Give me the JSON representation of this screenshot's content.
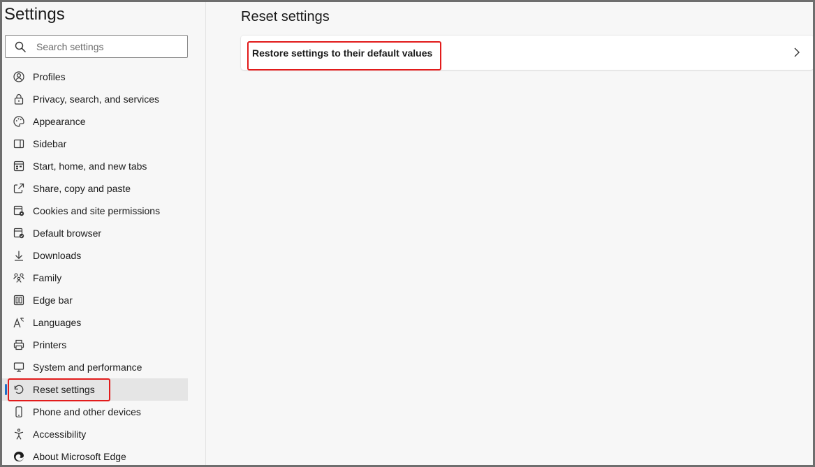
{
  "sidebar": {
    "title": "Settings",
    "search": {
      "placeholder": "Search settings",
      "value": ""
    },
    "items": [
      {
        "label": "Profiles",
        "icon": "profile-icon"
      },
      {
        "label": "Privacy, search, and services",
        "icon": "lock-icon"
      },
      {
        "label": "Appearance",
        "icon": "palette-icon"
      },
      {
        "label": "Sidebar",
        "icon": "sidebar-icon"
      },
      {
        "label": "Start, home, and new tabs",
        "icon": "home-tabs-icon"
      },
      {
        "label": "Share, copy and paste",
        "icon": "share-icon"
      },
      {
        "label": "Cookies and site permissions",
        "icon": "cookies-icon"
      },
      {
        "label": "Default browser",
        "icon": "browser-icon"
      },
      {
        "label": "Downloads",
        "icon": "download-icon"
      },
      {
        "label": "Family",
        "icon": "family-icon"
      },
      {
        "label": "Edge bar",
        "icon": "edge-bar-icon"
      },
      {
        "label": "Languages",
        "icon": "languages-icon"
      },
      {
        "label": "Printers",
        "icon": "printer-icon"
      },
      {
        "label": "System and performance",
        "icon": "system-icon"
      },
      {
        "label": "Reset settings",
        "icon": "reset-icon",
        "active": true
      },
      {
        "label": "Phone and other devices",
        "icon": "phone-icon"
      },
      {
        "label": "Accessibility",
        "icon": "accessibility-icon"
      },
      {
        "label": "About Microsoft Edge",
        "icon": "edge-logo-icon"
      }
    ]
  },
  "main": {
    "title": "Reset settings",
    "card": {
      "label": "Restore settings to their default values"
    }
  },
  "colors": {
    "accent": "#1f6fc5",
    "highlight": "#e21b1b",
    "background": "#f7f7f7",
    "active_item": "#e5e5e5"
  }
}
